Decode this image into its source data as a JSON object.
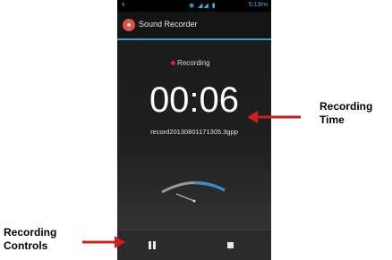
{
  "status_bar": {
    "time": "5:13",
    "time_suffix": "PM"
  },
  "app": {
    "title": "Sound Recorder"
  },
  "recorder": {
    "status": "Recording",
    "elapsed": "00:06",
    "filename": "record20130801171305.3gpp"
  },
  "controls": {
    "pause": "pause-icon",
    "stop": "stop-icon"
  },
  "annotations": {
    "time_line1": "Recording",
    "time_line2": "Time",
    "controls_line1": "Recording",
    "controls_line2": "Controls"
  },
  "colors": {
    "accent": "#3a9fc4",
    "record_dot": "#d9261c",
    "arrow": "#cc1f1f"
  }
}
